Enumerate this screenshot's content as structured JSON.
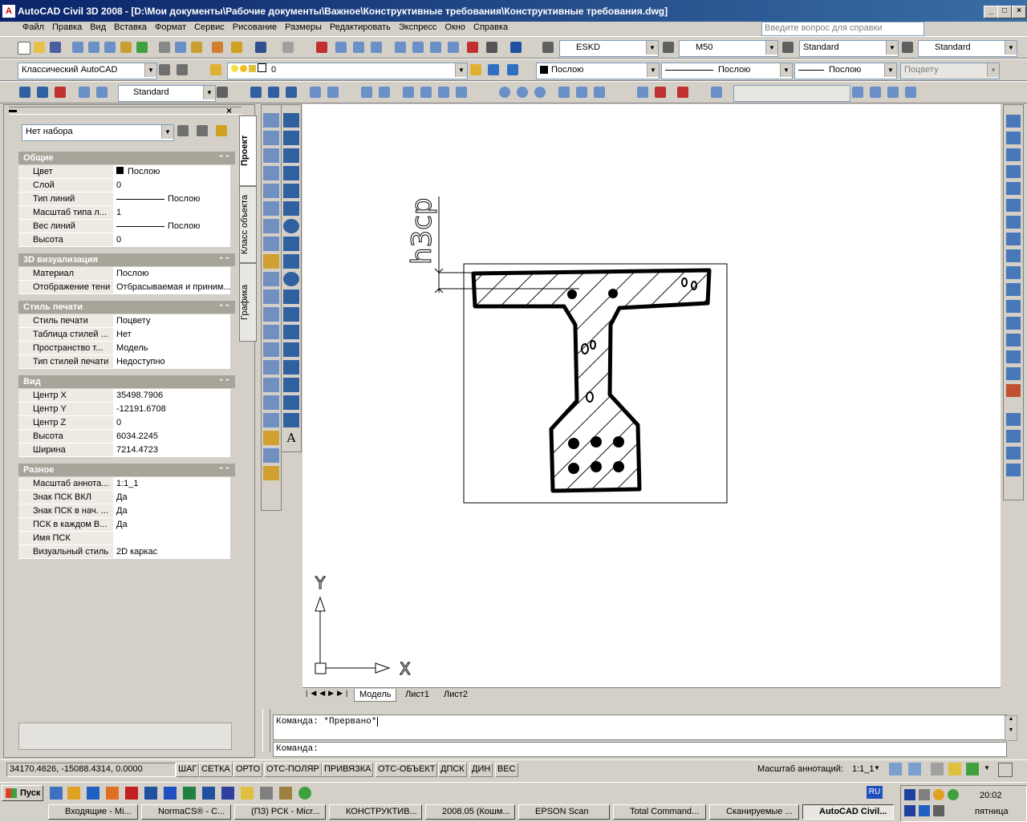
{
  "window": {
    "title": "AutoCAD Civil 3D 2008 - [D:\\Мои документы\\Рабочие документы\\Важное\\Конструктивные требования\\Конструктивные требования.dwg]"
  },
  "menu": [
    "Файл",
    "Правка",
    "Вид",
    "Вставка",
    "Формат",
    "Сервис",
    "Рисование",
    "Размеры",
    "Редактировать",
    "Экспресс",
    "Окно",
    "Справка"
  ],
  "help": {
    "placeholder": "Введите вопрос для справки"
  },
  "toolbar2": {
    "text_style": "ESKD",
    "dim_style": "M50",
    "table_style": "Standard",
    "mleader_style": "Standard"
  },
  "toolbar3": {
    "workspace": "Классический AutoCAD",
    "layer": "0",
    "color": "Послою",
    "linetype": "Послою",
    "lineweight": "Послою",
    "plotstyle": "Поцвету"
  },
  "toolbar4": {
    "style": "Standard"
  },
  "props": {
    "selection": "Нет набора",
    "sections": [
      {
        "title": "Общие",
        "rows": [
          [
            "Цвет",
            "Послою"
          ],
          [
            "Слой",
            "0"
          ],
          [
            "Тип линий",
            "Послою"
          ],
          [
            "Масштаб типа л...",
            "1"
          ],
          [
            "Вес линий",
            "Послою"
          ],
          [
            "Высота",
            "0"
          ]
        ]
      },
      {
        "title": "3D визуализация",
        "rows": [
          [
            "Материал",
            "Послою"
          ],
          [
            "Отображение тени",
            "Отбрасываемая и приним..."
          ]
        ]
      },
      {
        "title": "Стиль печати",
        "rows": [
          [
            "Стиль печати",
            "Поцвету"
          ],
          [
            "Таблица стилей ...",
            "Нет"
          ],
          [
            "Пространство т...",
            "Модель"
          ],
          [
            "Тип стилей печати",
            "Недоступно"
          ]
        ]
      },
      {
        "title": "Вид",
        "rows": [
          [
            "Центр X",
            "35498.7906"
          ],
          [
            "Центр Y",
            "-12191.6708"
          ],
          [
            "Центр Z",
            "0"
          ],
          [
            "Высота",
            "6034.2245"
          ],
          [
            "Ширина",
            "7214.4723"
          ]
        ]
      },
      {
        "title": "Разное",
        "rows": [
          [
            "Масштаб аннота...",
            "1:1_1"
          ],
          [
            "Знак ПСК ВКЛ",
            "Да"
          ],
          [
            "Знак ПСК в нач. ...",
            "Да"
          ],
          [
            "ПСК в каждом В...",
            "Да"
          ],
          [
            "Имя ПСК",
            ""
          ],
          [
            "Визуальный стиль",
            "2D каркас"
          ]
        ]
      }
    ]
  },
  "vtabs": [
    "Проект",
    "Класс объекта",
    "Графика"
  ],
  "drawing": {
    "dim_label": "h3cp",
    "ucs_y": "Y",
    "ucs_x": "X"
  },
  "layout_tabs": [
    "Модель",
    "Лист1",
    "Лист2"
  ],
  "command": {
    "line1": "Команда: *Прервано*",
    "line2": "Команда:"
  },
  "status": {
    "coords": "34170.4626, -15088.4314, 0.0000",
    "buttons": [
      "ШАГ",
      "СЕТКА",
      "ОРТО",
      "ОТС-ПОЛЯР",
      "ПРИВЯЗКА",
      "ОТС-ОБЪЕКТ",
      "ДПСК",
      "ДИН",
      "ВЕС"
    ],
    "annot_label": "Масштаб аннотаций:",
    "annot_value": "1:1_1"
  },
  "taskbar": {
    "start": "Пуск",
    "tasks": [
      "Входящие - Mi...",
      "NormaCS® - C...",
      "(ПЗ) РСК - Micr...",
      "КОНСТРУКТИВ...",
      "2008.05 (Кошм...",
      "EPSON Scan",
      "Total Command...",
      "Сканируемые ...",
      "AutoCAD Civil..."
    ],
    "lang": "RU",
    "time": "20:02",
    "day": "пятница"
  }
}
